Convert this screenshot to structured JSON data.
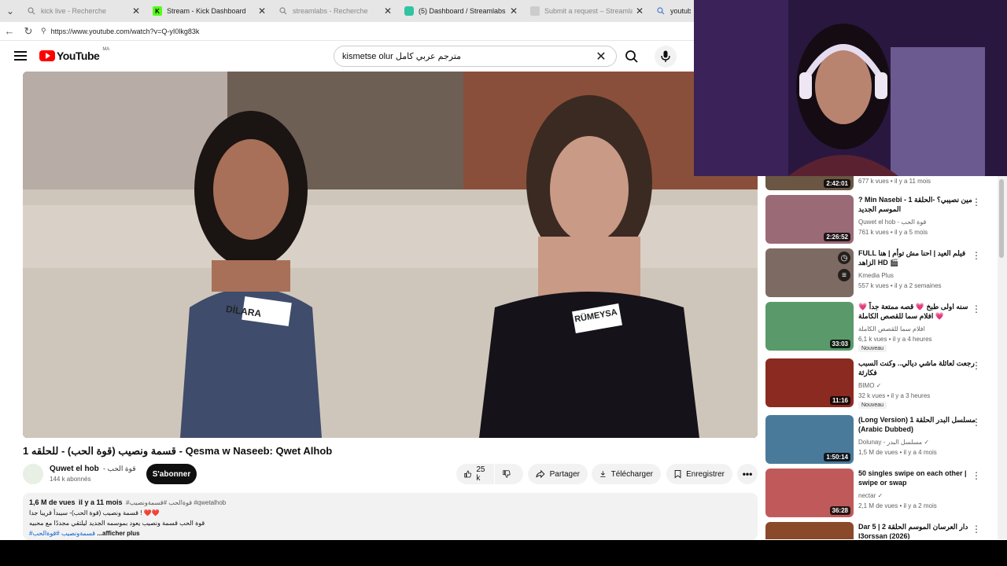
{
  "browser": {
    "tabs": [
      {
        "label": "kick live - Recherche",
        "icon": "search-icon"
      },
      {
        "label": "Stream - Kick Dashboard",
        "icon": "kick-icon"
      },
      {
        "label": "streamlabs - Recherche",
        "icon": "search-icon"
      },
      {
        "label": "(5) Dashboard / Streamlabs",
        "icon": "streamlabs-icon"
      },
      {
        "label": "Submit a request – Streamlabs",
        "icon": "globe-icon"
      },
      {
        "label": "youtube - R",
        "icon": "search-icon"
      }
    ],
    "url": "https://www.youtube.com/watch?v=Q-yI0lkg83k"
  },
  "youtube": {
    "logo_text": "YouTube",
    "country_code": "MA",
    "search_query": "kismetse olur مترجم عربي كامل"
  },
  "video": {
    "title": "1 قسمة ونصيب (قوة الحب) - للحلقه - Qesma w Naseeb: Qwet Alhob",
    "name_tags": [
      "DİLARA",
      "RÜMEYSA"
    ]
  },
  "channel": {
    "name": "Quwet el hob",
    "name_ar": "- قوة الحب",
    "subscribers": "144 k abonnés",
    "subscribe_label": "S'abonner"
  },
  "actions": {
    "likes": "25 k",
    "share": "Partager",
    "download": "Télécharger",
    "save": "Enregistrer"
  },
  "description": {
    "views": "1,6 M de vues",
    "date": "il y a 11 mois",
    "tags": "#قوةالحب #قسمةونصيب #qwetalhob",
    "line1": "قسمة ونصيب (قوة الحب)- سيبدأ قريبا جدا ! ❤️❤️",
    "line2": "قوة الحب قسمة ونصيب يعود بموسمه الجديد ليلتقي مجددًا مع محبيه",
    "hashtags": "#قسمةونصيب #قوةالحب",
    "more": "...afficher plus"
  },
  "recommendations": [
    {
      "title": "",
      "channel": "",
      "views": "677 k vues • il y a 11 mois",
      "duration": "2:42:01",
      "badge": ""
    },
    {
      "title": "? Min Nasebi - 1 مين نصيبي؟ -الحلقة الموسم الجديد",
      "channel": "Quwet el hob - قوة الحب",
      "views": "761 k vues • il y a 5 mois",
      "duration": "2:26:52",
      "badge": ""
    },
    {
      "title": "FULL فيلم العيد | احنا مش توأم | هنا الزاهد HD 🎬",
      "channel": "Kmedia Plus",
      "views": "557 k vues • il y a 2 semaines",
      "duration": "",
      "badge": ""
    },
    {
      "title": "سنه اولى طبخ 💗 قصه ممتعة جداً 💗 افلام سما للقصص الكاملة 💗",
      "channel": "افلام سما للقصص الكاملة",
      "views": "6,1 k vues • il y a 4 heures",
      "duration": "33:03",
      "badge": "Nouveau"
    },
    {
      "title": "رجعت لعائلة ماشي ديالي.. وكنت السبب فكارثة",
      "channel": "BIMO ✓",
      "views": "32 k vues • il y a 3 heures",
      "duration": "11:16",
      "badge": "Nouveau"
    },
    {
      "title": "(Long Version) 1 مسلسل البدر الحلقة (Arabic Dubbed)",
      "channel": "Dolunay - مسلسل البدر ✓",
      "views": "1,5 M de vues • il y a 4 mois",
      "duration": "1:50:14",
      "badge": ""
    },
    {
      "title": "50 singles swipe on each other | swipe or swap",
      "channel": "nectar ✓",
      "views": "2,1 M de vues • il y a 2 mois",
      "duration": "36:28",
      "badge": ""
    },
    {
      "title": "Dar 5 | 2 دار العرسان الموسم الحلقة l3orssan (2026)",
      "channel": "",
      "views": "",
      "duration": "",
      "badge": ""
    }
  ],
  "colors": {
    "youtube_red": "#ff0000",
    "subscribe_bg": "#0f0f0f",
    "kick_green": "#53fc18",
    "streamlabs_teal": "#31c3a2"
  }
}
